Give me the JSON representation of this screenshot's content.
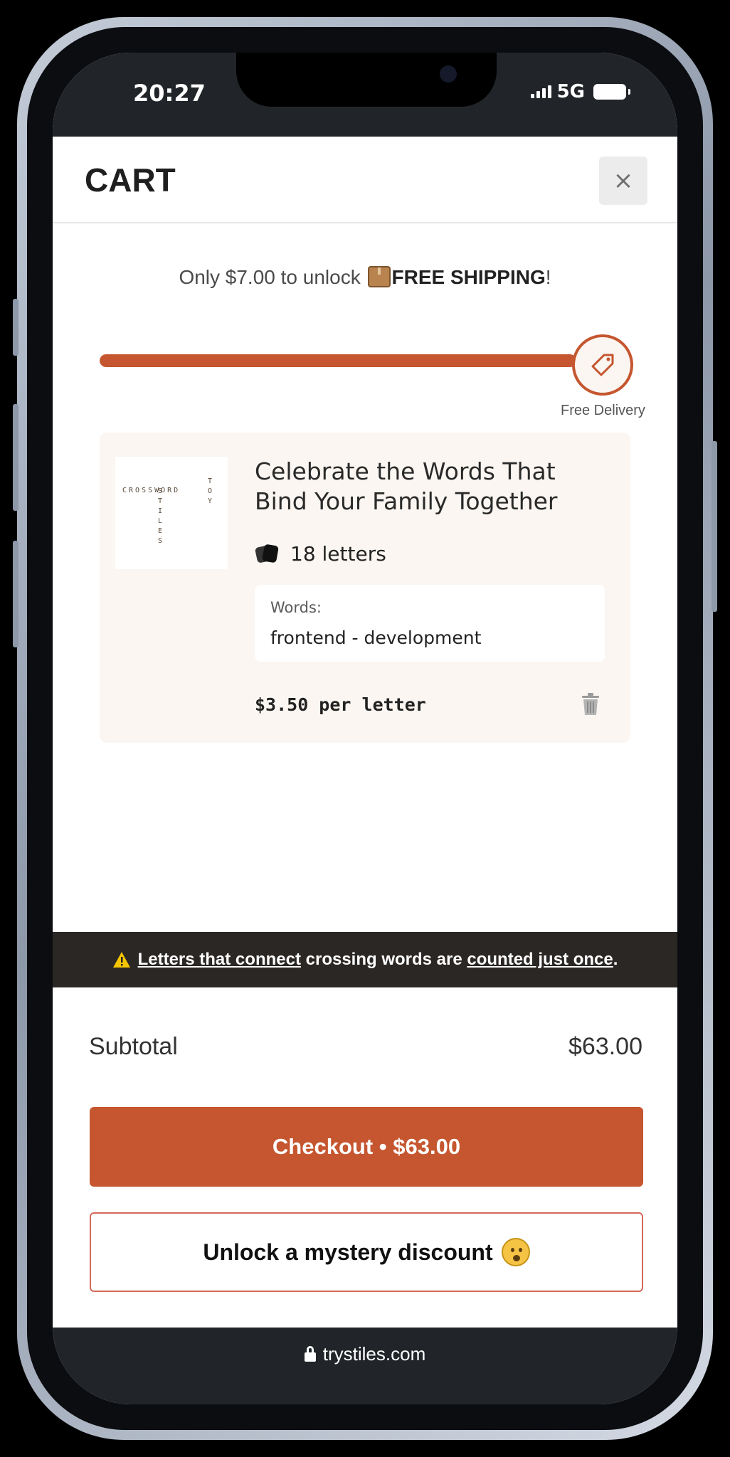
{
  "status_bar": {
    "time": "20:27",
    "network": "5G"
  },
  "cart": {
    "title": "CART",
    "close_label": "×"
  },
  "shipping": {
    "prefix": "Only $7.00 to unlock",
    "highlight": "FREE SHIPPING",
    "suffix": "!",
    "progress_percent": 100,
    "goal_label": "Free Delivery"
  },
  "item": {
    "thumbnail_text": {
      "row": "CROSSWORD",
      "col1": "STILES",
      "col2": "TOY"
    },
    "title": "Celebrate the Words That Bind Your Family Together",
    "letters": "18 letters",
    "words_label": "Words:",
    "words_value": "frontend - development",
    "price_per_letter": "$3.50 per letter"
  },
  "notice": {
    "part1": "Letters that connect",
    "part2": "crossing words are",
    "part3": "counted just once",
    "part4": "."
  },
  "summary": {
    "subtotal_label": "Subtotal",
    "subtotal_value": "$63.00"
  },
  "buttons": {
    "checkout": "Checkout • $63.00",
    "mystery": "Unlock a mystery discount"
  },
  "browser": {
    "url": "trystiles.com"
  },
  "colors": {
    "accent": "#c5562f",
    "card_bg": "#fbf6f1",
    "dark_bar": "#2b2725"
  }
}
